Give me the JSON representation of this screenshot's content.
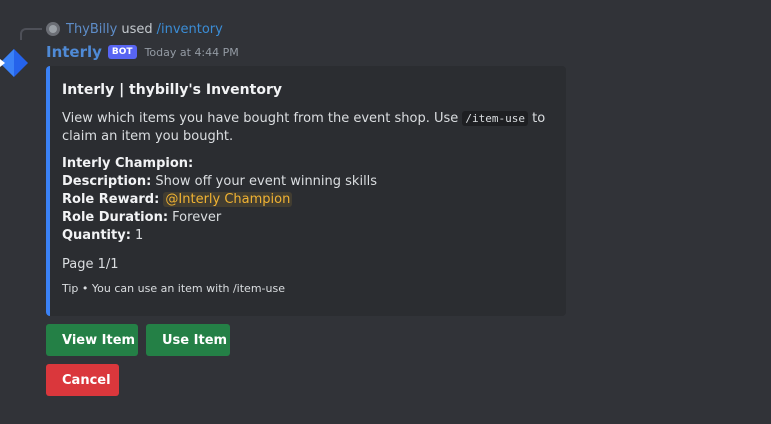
{
  "reply": {
    "username": "ThyBilly",
    "used_text": "used",
    "command": "/inventory"
  },
  "message": {
    "bot_name": "Interly",
    "bot_tag": "BOT",
    "timestamp": "Today at 4:44 PM"
  },
  "embed": {
    "accent_color": "#3b82f6",
    "title": "Interly | thybilly's Inventory",
    "description_before": "View which items you have bought from the event shop. Use",
    "description_code": "/item-use",
    "description_after": "to claim an item you bought.",
    "item_name": "Interly Champion:",
    "fields": {
      "description_label": "Description:",
      "description_value": "Show off your event winning skills",
      "role_reward_label": "Role Reward:",
      "role_reward_value": "@Interly Champion",
      "role_duration_label": "Role Duration:",
      "role_duration_value": "Forever",
      "quantity_label": "Quantity:",
      "quantity_value": "1"
    },
    "page": "Page 1/1",
    "footer": "Tip • You can use an item with /item-use"
  },
  "buttons": {
    "view_item": "View Item",
    "use_item": "Use Item",
    "cancel": "Cancel"
  },
  "colors": {
    "background": "#313338",
    "embed_background": "#2b2d31",
    "bot_name": "#4f8ad6",
    "bot_tag": "#5865f2",
    "role_mention": "#f0b232",
    "button_green": "#248046",
    "button_red": "#da373c"
  },
  "icons": {
    "bot_avatar": "blue-diamond-icon",
    "reply_avatar": "user-avatar-icon"
  }
}
